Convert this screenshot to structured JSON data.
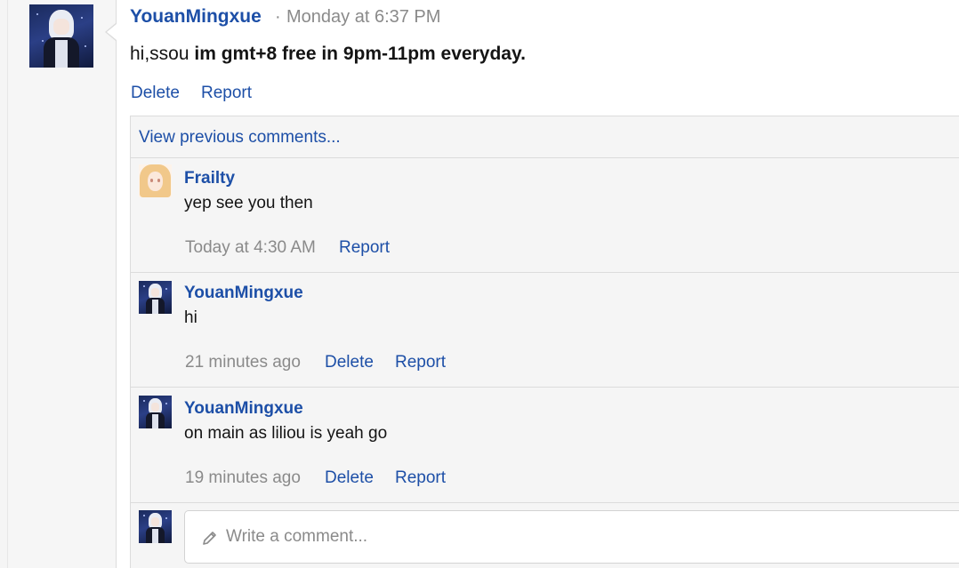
{
  "post": {
    "author": "YouanMingxue",
    "separator": "·",
    "time": "Monday at 6:37 PM",
    "body_plain": "hi,ssou ",
    "body_bold": "im gmt+8 free in 9pm-11pm everyday.",
    "delete_label": "Delete",
    "report_label": "Report"
  },
  "comments": {
    "view_previous": "View previous comments...",
    "items": [
      {
        "author": "Frailty",
        "text": "yep see you then",
        "time": "Today at 4:30 AM",
        "report_label": "Report",
        "avatar": "anime-girl-blonde-avatar"
      },
      {
        "author": "YouanMingxue",
        "text": "hi",
        "time": "21 minutes ago",
        "delete_label": "Delete",
        "report_label": "Report",
        "avatar": "anime-boy-night-avatar"
      },
      {
        "author": "YouanMingxue",
        "text": "on main as liliou is yeah go",
        "time": "19 minutes ago",
        "delete_label": "Delete",
        "report_label": "Report",
        "avatar": "anime-boy-night-avatar"
      }
    ],
    "compose": {
      "placeholder": "Write a comment...",
      "icon": "pencil-icon"
    }
  },
  "colors": {
    "link": "#1d4fa7",
    "muted": "#8a8a8a",
    "comment_bg": "#f5f5f5",
    "border": "#dcdcdc"
  }
}
